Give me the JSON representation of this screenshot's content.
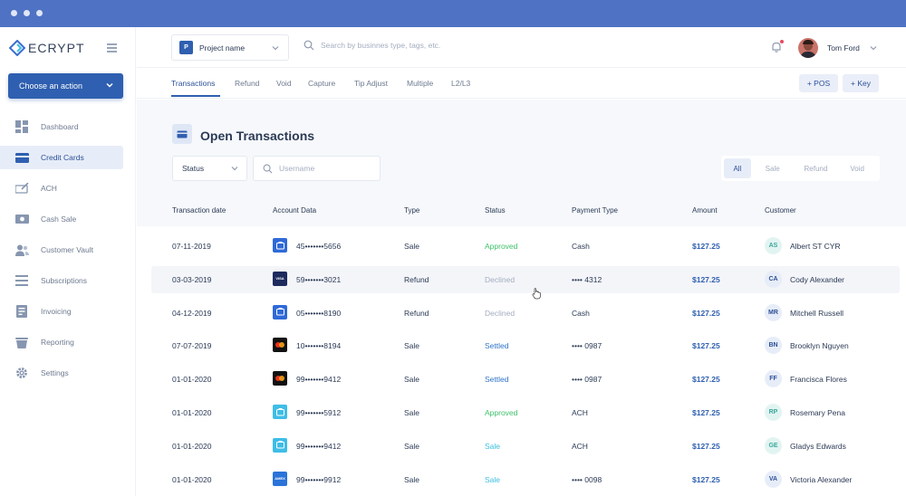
{
  "app": {
    "logo_text": "ECRYPT"
  },
  "sidebar": {
    "action_label": "Choose an action",
    "items": [
      {
        "label": "Dashboard",
        "icon": "dashboard-icon",
        "active": false
      },
      {
        "label": "Credit Cards",
        "icon": "credit-card-icon",
        "active": true
      },
      {
        "label": "ACH",
        "icon": "check-icon",
        "active": false
      },
      {
        "label": "Cash Sale",
        "icon": "cash-icon",
        "active": false
      },
      {
        "label": "Customer Vault",
        "icon": "users-icon",
        "active": false
      },
      {
        "label": "Subscriptions",
        "icon": "list-icon",
        "active": false
      },
      {
        "label": "Invoicing",
        "icon": "invoice-icon",
        "active": false
      },
      {
        "label": "Reporting",
        "icon": "reporting-icon",
        "active": false
      },
      {
        "label": "Settings",
        "icon": "gear-icon",
        "active": false
      }
    ]
  },
  "header": {
    "project_badge": "P",
    "project_label": "Project name",
    "search_placeholder": "Search by businnes type, tags, etc.",
    "user_name": "Tom Ford"
  },
  "tabs": {
    "items": [
      "Transactions",
      "Refund",
      "Void",
      "Capture",
      "Tip Adjust",
      "Multiple",
      "L2/L3"
    ],
    "active": "Transactions",
    "pos_label": "+ POS",
    "key_label": "+ Key"
  },
  "section": {
    "title": "Open Transactions",
    "status_label": "Status",
    "username_placeholder": "Username",
    "filters": [
      "All",
      "Sale",
      "Refund",
      "Void"
    ],
    "active_filter": "All"
  },
  "table": {
    "columns": [
      "Transaction date",
      "Account Data",
      "Type",
      "Status",
      "Payment Type",
      "Amount",
      "Customer"
    ],
    "rows": [
      {
        "date": "07-11-2019",
        "card": "blue",
        "card_text": "",
        "account": "45•••••••5656",
        "type": "Sale",
        "status": "Approved",
        "status_kind": "approved",
        "payment": "Cash",
        "amount": "$127.25",
        "initials": "AS",
        "initials_style": "teal",
        "customer": "Albert ST CYR"
      },
      {
        "date": "03-03-2019",
        "card": "visa",
        "card_text": "VISA",
        "account": "59•••••••3021",
        "type": "Refund",
        "status": "Declined",
        "status_kind": "declined",
        "payment": "•••• 4312",
        "amount": "$127.25",
        "initials": "CA",
        "initials_style": "blue",
        "customer": "Cody Alexander"
      },
      {
        "date": "04-12-2019",
        "card": "blue",
        "card_text": "",
        "account": "05•••••••8190",
        "type": "Refund",
        "status": "Declined",
        "status_kind": "declined",
        "payment": "Cash",
        "amount": "$127.25",
        "initials": "MR",
        "initials_style": "blue",
        "customer": "Mitchell Russell"
      },
      {
        "date": "07-07-2019",
        "card": "mastercard",
        "card_text": "",
        "account": "10•••••••8194",
        "type": "Sale",
        "status": "Settled",
        "status_kind": "settled",
        "payment": "•••• 0987",
        "amount": "$127.25",
        "initials": "BN",
        "initials_style": "blue",
        "customer": "Brooklyn Nguyen"
      },
      {
        "date": "01-01-2020",
        "card": "mastercard",
        "card_text": "",
        "account": "99•••••••9412",
        "type": "Sale",
        "status": "Settled",
        "status_kind": "settled",
        "payment": "•••• 0987",
        "amount": "$127.25",
        "initials": "FF",
        "initials_style": "blue",
        "customer": "Francisca Flores"
      },
      {
        "date": "01-01-2020",
        "card": "cyan",
        "card_text": "",
        "account": "99•••••••5912",
        "type": "Sale",
        "status": "Approved",
        "status_kind": "approved",
        "payment": "ACH",
        "amount": "$127.25",
        "initials": "RP",
        "initials_style": "teal",
        "customer": "Rosemary Pena"
      },
      {
        "date": "01-01-2020",
        "card": "cyan",
        "card_text": "",
        "account": "99•••••••9412",
        "type": "Sale",
        "status": "Sale",
        "status_kind": "sale",
        "payment": "ACH",
        "amount": "$127.25",
        "initials": "GE",
        "initials_style": "teal",
        "customer": "Gladys Edwards"
      },
      {
        "date": "01-01-2020",
        "card": "amex",
        "card_text": "AMEX",
        "account": "99•••••••9912",
        "type": "Sale",
        "status": "Sale",
        "status_kind": "sale",
        "payment": "•••• 0098",
        "amount": "$127.25",
        "initials": "VA",
        "initials_style": "blue",
        "customer": "Victoria Alexander"
      }
    ],
    "highlighted_row": 1
  },
  "colors": {
    "chrome": "#4f72c4",
    "primary": "#2f5fb0",
    "approved": "#3fc16a",
    "declined": "#a3adbf",
    "settled": "#2f74c8",
    "sale": "#3cbde0"
  }
}
